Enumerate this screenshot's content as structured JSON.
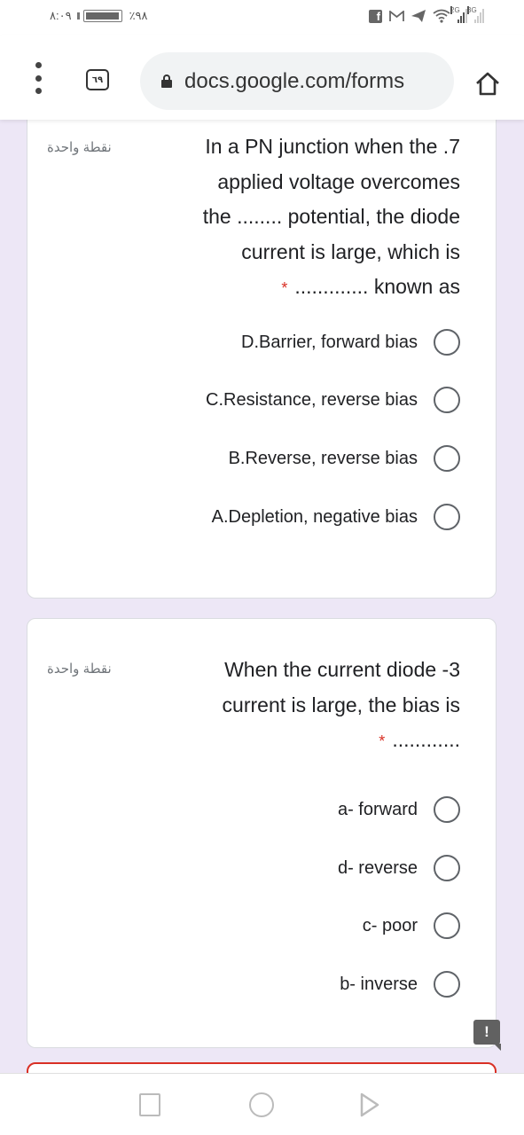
{
  "status_bar": {
    "time": "٨:٠٩",
    "battery_percent_label": "٪٩٨",
    "battery_level": 0.98,
    "notification_icons": [
      "facebook-icon",
      "gmail-icon",
      "telegram-icon",
      "wifi-icon"
    ],
    "signal_labels": [
      "2G",
      "3G"
    ]
  },
  "browser": {
    "tab_count": "٦٩",
    "url": "docs.google.com/forms"
  },
  "questions": [
    {
      "points": "نقطة واحدة",
      "lines": [
        "In a PN junction when the .7",
        "applied voltage overcomes",
        "the ........ potential, the diode",
        "current is large, which is",
        "............. known as"
      ],
      "required_mark": "*",
      "options": [
        {
          "label": "D.Barrier, forward bias",
          "selected": false
        },
        {
          "label": "C.Resistance, reverse bias",
          "selected": false
        },
        {
          "label": "B.Reverse, reverse bias",
          "selected": false
        },
        {
          "label": "A.Depletion, negative bias",
          "selected": false
        }
      ]
    },
    {
      "points": "نقطة واحدة",
      "lines": [
        "When the current diode -3",
        "current is large, the bias is",
        "............"
      ],
      "required_mark": "*",
      "options": [
        {
          "label": "a- forward",
          "selected": false
        },
        {
          "label": "d- reverse",
          "selected": false
        },
        {
          "label": "c- poor",
          "selected": false
        },
        {
          "label": "b- inverse",
          "selected": false
        }
      ]
    }
  ],
  "feedback_button": "!",
  "colors": {
    "page_background": "#ede7f6",
    "required": "#d93025",
    "error_border": "#d93025"
  }
}
